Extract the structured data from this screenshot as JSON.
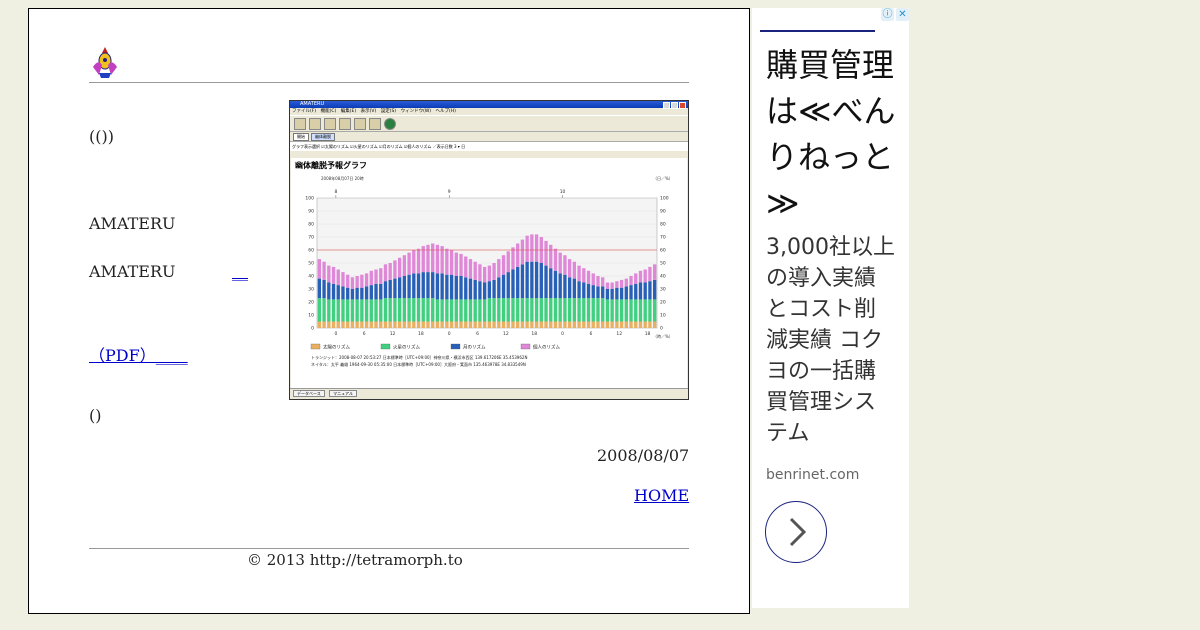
{
  "content": {
    "paragraph_1": "(())",
    "paragraph_2": "AMATERU",
    "paragraph_3": "AMATERU",
    "paragraph_3_link": "__",
    "pdf_link": "（PDF）____",
    "paragraph_5": "()",
    "date": "2008/08/07",
    "home_link": "HOME",
    "copyright": "© 2013  http://tetramorph.to"
  },
  "screenshot": {
    "window_title": "AMATERU",
    "menu": "ファイル(F)　機能(C)　編集(E)　表示(V)　設定(S)　ウィンドウ(W)　ヘルプ(H)",
    "tabs": [
      "開始",
      "幽体離脱"
    ],
    "options": "グラフ表示選択  ☑太陽のリズム  ☑火星のリズム  ☑月のリズム  ☑個人のリズム  ／表示日数 3 ▾ 日",
    "status_items": [
      "データベース",
      "マニュアル"
    ]
  },
  "chart_data": {
    "type": "bar",
    "stacked": true,
    "title": "幽体離脱予報グラフ",
    "datetime_label": "2008年08月07日 20時",
    "top_ticks": [
      "8",
      "9",
      "10"
    ],
    "bottom_ticks": [
      "0",
      "6",
      "12",
      "18",
      "0",
      "6",
      "12",
      "18",
      "0",
      "6",
      "12",
      "18"
    ],
    "ylim": [
      0,
      100
    ],
    "yticks": [
      0,
      10,
      20,
      30,
      40,
      50,
      60,
      70,
      80,
      90,
      100
    ],
    "unit_top": "（日／%）",
    "unit_bottom": "（時／%）",
    "threshold": 60,
    "series": [
      {
        "name": "太陽のリズム",
        "color": "#e8b060",
        "values": [
          5,
          5,
          5,
          5,
          5,
          5,
          5,
          5,
          5,
          5,
          5,
          5,
          5,
          5,
          5,
          5,
          5,
          5,
          5,
          5,
          5,
          5,
          5,
          5,
          5,
          5,
          5,
          5,
          5,
          5,
          5,
          5,
          5,
          5,
          5,
          5,
          5,
          5,
          5,
          5,
          5,
          5,
          5,
          5,
          5,
          5,
          5,
          5,
          5,
          5,
          5,
          5,
          5,
          5,
          5,
          5,
          5,
          5,
          5,
          5,
          5,
          5,
          5,
          5,
          5,
          5,
          5,
          5,
          5,
          5,
          5,
          5
        ]
      },
      {
        "name": "火星のリズム",
        "color": "#40d080",
        "values": [
          18,
          18,
          17,
          17,
          17,
          17,
          17,
          17,
          17,
          17,
          17,
          17,
          17,
          17,
          18,
          18,
          18,
          18,
          18,
          18,
          18,
          18,
          18,
          18,
          18,
          17,
          17,
          17,
          17,
          17,
          17,
          17,
          17,
          17,
          17,
          17,
          18,
          18,
          18,
          18,
          18,
          18,
          18,
          18,
          18,
          18,
          18,
          18,
          18,
          18,
          18,
          18,
          18,
          18,
          18,
          18,
          18,
          18,
          18,
          18,
          18,
          17,
          17,
          17,
          17,
          17,
          17,
          17,
          17,
          17,
          17,
          17
        ]
      },
      {
        "name": "月のリズム",
        "color": "#2860b8",
        "values": [
          15,
          14,
          13,
          12,
          11,
          10,
          9,
          8,
          9,
          9,
          10,
          11,
          12,
          12,
          13,
          14,
          15,
          16,
          17,
          18,
          19,
          19,
          20,
          20,
          20,
          20,
          20,
          19,
          19,
          18,
          18,
          17,
          16,
          15,
          14,
          13,
          13,
          14,
          16,
          18,
          20,
          22,
          24,
          26,
          28,
          28,
          28,
          27,
          25,
          23,
          21,
          19,
          18,
          16,
          15,
          13,
          12,
          11,
          10,
          9,
          9,
          8,
          8,
          9,
          9,
          10,
          11,
          12,
          13,
          13,
          14,
          15
        ]
      },
      {
        "name": "個人のリズム",
        "color": "#e088d8",
        "values": [
          15,
          14,
          13,
          13,
          12,
          11,
          10,
          9,
          9,
          10,
          10,
          11,
          11,
          12,
          13,
          13,
          14,
          15,
          16,
          17,
          18,
          19,
          20,
          21,
          22,
          22,
          21,
          20,
          19,
          18,
          17,
          16,
          15,
          14,
          13,
          12,
          12,
          13,
          14,
          15,
          16,
          17,
          18,
          19,
          20,
          21,
          21,
          20,
          19,
          18,
          17,
          16,
          15,
          14,
          13,
          12,
          11,
          10,
          9,
          8,
          7,
          5,
          5,
          5,
          6,
          6,
          7,
          8,
          9,
          10,
          11,
          12
        ]
      }
    ],
    "footer_lines": [
      "トランジット：2008-08-07 20:53:27 日本標準時［UTC+09:00］神奈川県・横浜市西区 139.617206E 35.453962N",
      "ネイタル：太平 義雄 1964-09-30 05:35:00 日本標準時［UTC+09:00］大阪府・箕面市 135.463978E 34.833549N"
    ]
  },
  "ad": {
    "headline": "購買管理は≪べんりねっと≫",
    "body": "3,000社以上の導入実績とコスト削減実績 コクヨの一括購買管理システム",
    "url": "benrinet.com",
    "info_icon": "info-icon",
    "close_icon": "close-icon",
    "arrow_icon": "chevron-right-icon"
  }
}
